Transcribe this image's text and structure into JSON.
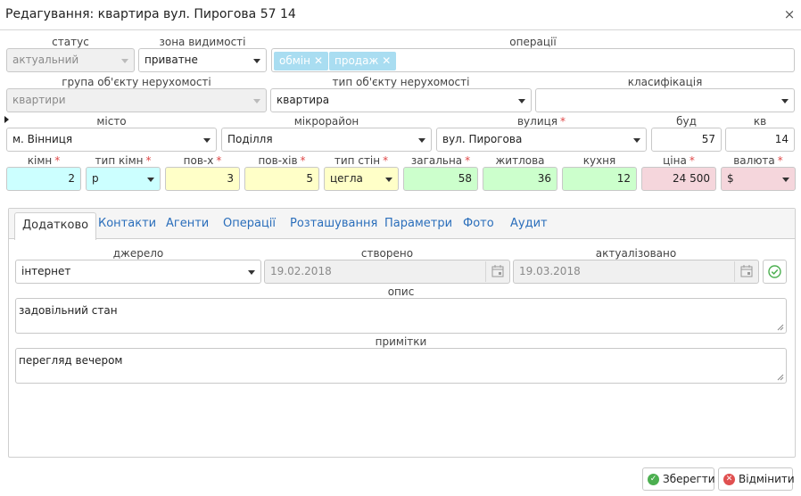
{
  "window": {
    "title": "Редагування: квартира вул. Пирогова 57 14",
    "close_glyph": "×"
  },
  "labels": {
    "status": "статус",
    "visibility": "зона видимості",
    "operations": "операції",
    "object_group": "група об'єкту нерухомості",
    "object_type": "тип об'єкту нерухомості",
    "classification": "класифікація",
    "city": "місто",
    "district": "мікрорайон",
    "street": "вулиця",
    "building": "буд",
    "apartment": "кв",
    "rooms": "кімн",
    "room_type": "тип кімн",
    "floor": "пов-х",
    "floors_total": "пов-хів",
    "wall_type": "тип стін",
    "total_area": "загальна",
    "living_area": "житлова",
    "kitchen": "кухня",
    "price": "ціна",
    "currency": "валюта"
  },
  "values": {
    "status": "актуальний",
    "visibility": "приватне",
    "operations": [
      "обмін",
      "продаж"
    ],
    "object_group": "квартири",
    "object_type": "квартира",
    "classification": "",
    "city": "м. Вінниця",
    "district": "Поділля",
    "street": "вул. Пирогова",
    "building": "57",
    "apartment": "14",
    "rooms": "2",
    "room_type": "р",
    "floor": "3",
    "floors_total": "5",
    "wall_type": "цегла",
    "total_area": "58",
    "living_area": "36",
    "kitchen": "12",
    "price": "24 500",
    "currency": "$"
  },
  "tabs": [
    "Додатково",
    "Контакти",
    "Агенти",
    "Операції",
    "Розташування",
    "Параметри",
    "Фото",
    "Аудит"
  ],
  "extra": {
    "source_label": "джерело",
    "created_label": "створено",
    "updated_label": "актуалізовано",
    "description_label": "опис",
    "notes_label": "примітки",
    "source": "інтернет",
    "created": "19.02.2018",
    "updated": "19.03.2018",
    "description": "задовільний стан",
    "notes": "перегляд вечером"
  },
  "buttons": {
    "save": "Зберегти",
    "cancel": "Відмінити"
  },
  "colors": {
    "accent": "#2a6ebb",
    "required": "#e04848",
    "tag": "#a9ddf1",
    "cyan_field": "#ccffff",
    "yellow_field": "#ffffc8",
    "green_field": "#ccffcc",
    "pink_field": "#f5d6dc",
    "save_icon": "#4caf50",
    "cancel_icon": "#e05050"
  },
  "icons": {
    "close": "close-icon",
    "calendar": "calendar-icon",
    "confirm": "check-circle-icon",
    "save": "check-circle-icon",
    "cancel": "cancel-circle-icon"
  }
}
